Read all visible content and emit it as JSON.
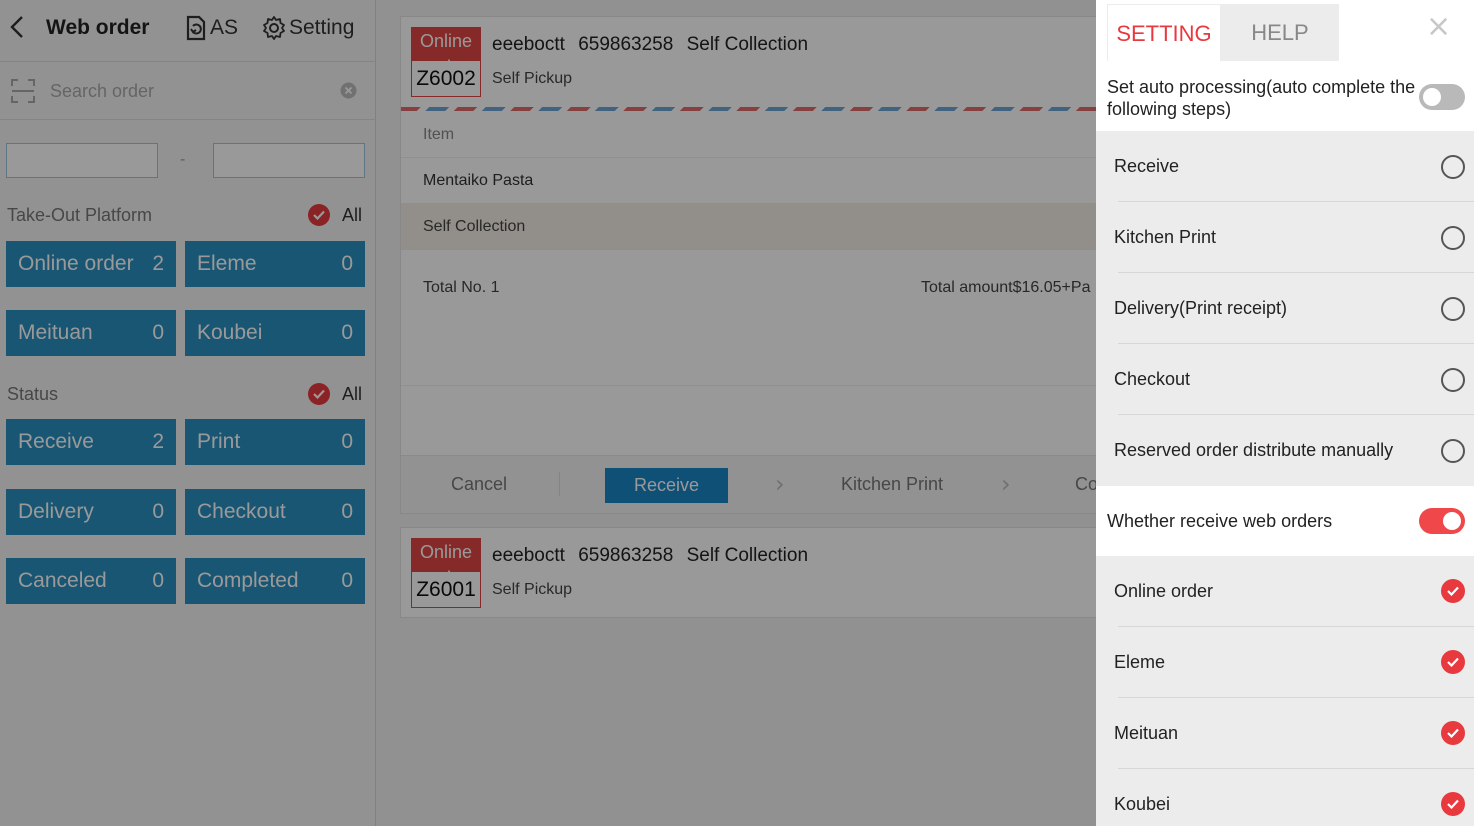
{
  "header": {
    "title": "Web order",
    "as_label": "AS",
    "setting_label": "Setting"
  },
  "search": {
    "placeholder": "Search order"
  },
  "date_range": {
    "from": "",
    "to": "",
    "separator": "-"
  },
  "platform": {
    "label": "Take-Out Platform",
    "all_label": "All",
    "tiles": [
      {
        "label": "Online order",
        "count": "2"
      },
      {
        "label": "Eleme",
        "count": "0"
      },
      {
        "label": "Meituan",
        "count": "0"
      },
      {
        "label": "Koubei",
        "count": "0"
      }
    ]
  },
  "status": {
    "label": "Status",
    "all_label": "All",
    "tiles": [
      {
        "label": "Receive",
        "count": "2"
      },
      {
        "label": "Print",
        "count": "0"
      },
      {
        "label": "Delivery",
        "count": "0"
      },
      {
        "label": "Checkout",
        "count": "0"
      },
      {
        "label": "Canceled",
        "count": "0"
      },
      {
        "label": "Completed",
        "count": "0"
      }
    ]
  },
  "orders": [
    {
      "badge_top": "Online order",
      "number": "Z6002",
      "customer": "eeeboctt",
      "phone": "659863258",
      "method": "Self Collection",
      "pickup": "Self Pickup",
      "item_header": "Item",
      "item": "Mentaiko Pasta",
      "collection_row": "Self Collection",
      "total_no": "Total No. 1",
      "total_amount": "Total amount$16.05+Pa",
      "actions": {
        "cancel": "Cancel",
        "receive": "Receive",
        "kitchen_print": "Kitchen Print",
        "next_partial": "Co"
      }
    },
    {
      "badge_top": "Online order",
      "number": "Z6001",
      "customer": "eeeboctt",
      "phone": "659863258",
      "method": "Self Collection",
      "pickup": "Self Pickup"
    }
  ],
  "settings_panel": {
    "tab_setting": "SETTING",
    "tab_help": "HELP",
    "close": "×",
    "auto_processing": {
      "label": "Set auto processing(auto complete the following steps)",
      "enabled": false
    },
    "steps": [
      "Receive",
      "Kitchen Print",
      "Delivery(Print receipt)",
      "Checkout",
      "Reserved order distribute manually"
    ],
    "receive_web_orders": {
      "label": "Whether receive web orders",
      "enabled": true
    },
    "platforms": [
      "Online order",
      "Eleme",
      "Meituan",
      "Koubei"
    ]
  },
  "colors": {
    "accent_red": "#e8393e",
    "tile_blue": "#2a8fc0",
    "primary_blue": "#1a86c7"
  }
}
